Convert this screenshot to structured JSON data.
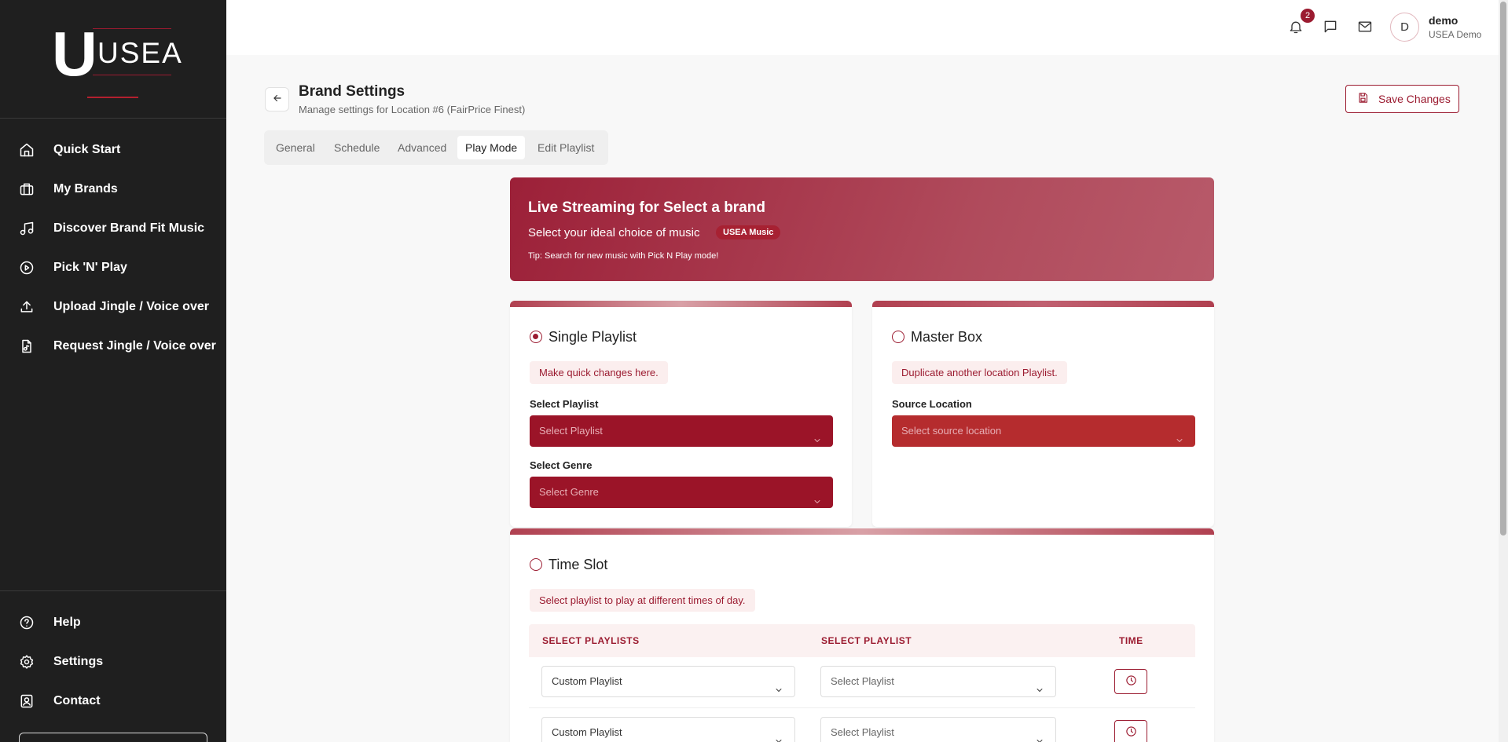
{
  "logo": {
    "letter": "U",
    "text": "USEA"
  },
  "sidebar": {
    "items": [
      {
        "label": "Quick Start",
        "icon": "home-icon"
      },
      {
        "label": "My Brands",
        "icon": "briefcase-icon"
      },
      {
        "label": "Discover Brand Fit Music",
        "icon": "music-note-icon"
      },
      {
        "label": "Pick 'N' Play",
        "icon": "play-circle-icon"
      },
      {
        "label": "Upload Jingle / Voice over",
        "icon": "upload-icon"
      },
      {
        "label": "Request Jingle / Voice over",
        "icon": "file-audio-icon"
      }
    ],
    "bottom_items": [
      {
        "label": "Help",
        "icon": "help-circle-icon"
      },
      {
        "label": "Settings",
        "icon": "gear-icon"
      },
      {
        "label": "Contact",
        "icon": "contact-icon"
      }
    ]
  },
  "topbar": {
    "notification_count": "2",
    "user": {
      "initial": "D",
      "name": "demo",
      "subtitle": "USEA Demo"
    }
  },
  "header": {
    "title": "Brand Settings",
    "subtitle": "Manage settings for Location #6 (FairPrice Finest)",
    "save_label": "Save Changes"
  },
  "tabs": [
    {
      "label": "General",
      "active": false
    },
    {
      "label": "Schedule",
      "active": false
    },
    {
      "label": "Advanced",
      "active": false
    },
    {
      "label": "Play Mode",
      "active": true
    },
    {
      "label": "Edit Playlist",
      "active": false
    }
  ],
  "hero": {
    "title": "Live Streaming for Select a brand",
    "subtitle": "Select your ideal choice of music",
    "pill": "USEA Music",
    "tip": "Tip: Search for new music with Pick N Play mode!"
  },
  "single_playlist": {
    "title": "Single Playlist",
    "selected": true,
    "hint": "Make quick changes here.",
    "playlist_label": "Select Playlist",
    "playlist_placeholder": "Select Playlist",
    "genre_label": "Select Genre",
    "genre_placeholder": "Select Genre"
  },
  "master_box": {
    "title": "Master Box",
    "selected": false,
    "hint": "Duplicate another location Playlist.",
    "source_label": "Source Location",
    "source_placeholder": "Select source location"
  },
  "time_slot": {
    "title": "Time Slot",
    "selected": false,
    "hint": "Select playlist to play at different times of day.",
    "columns": [
      "SELECT PLAYLISTS",
      "SELECT PLAYLIST",
      "TIME"
    ],
    "rows": [
      {
        "playlists": "Custom Playlist",
        "playlist": "Select Playlist"
      },
      {
        "playlists": "Custom Playlist",
        "playlist": "Select Playlist"
      }
    ]
  },
  "colors": {
    "accent": "#9b1b30",
    "sidebar_bg": "#1f1f1f",
    "dropdown_dark": "#9b1428",
    "dropdown_source": "#b52c2e"
  }
}
